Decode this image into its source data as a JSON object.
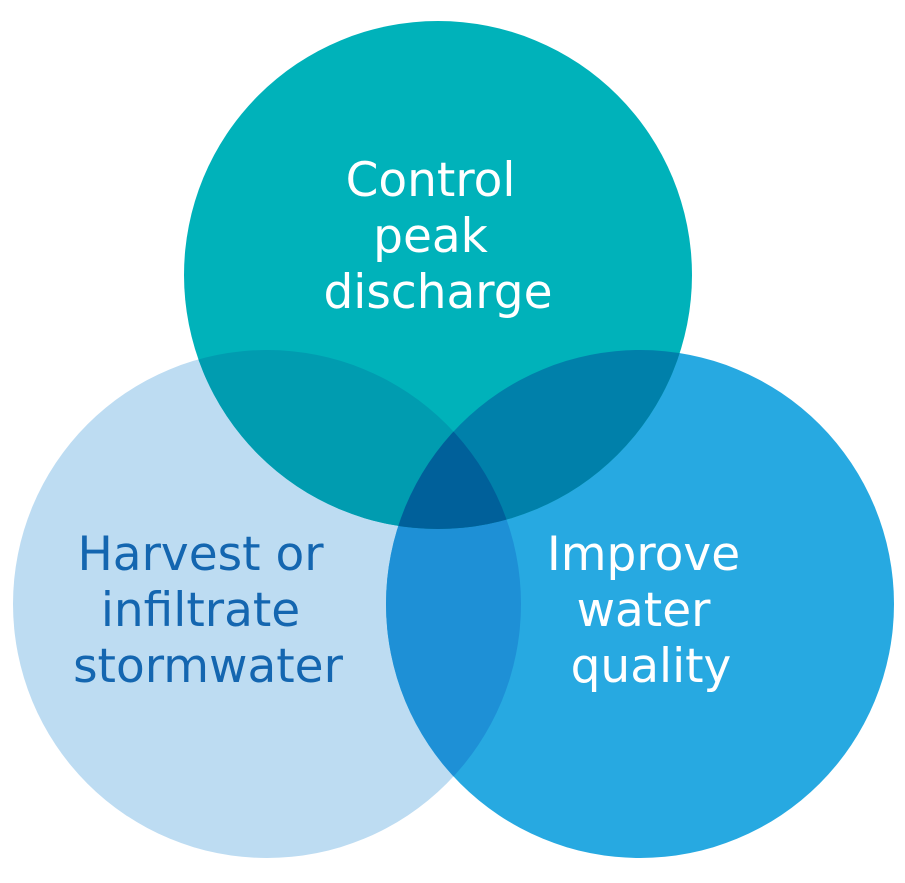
{
  "venn": {
    "circles": [
      {
        "id": "control-peak-discharge",
        "lines": [
          "Control",
          "peak",
          "discharge"
        ],
        "fill": "#00B2BA",
        "text_color": "#FFFFFF"
      },
      {
        "id": "harvest-or-infiltrate-stormwater",
        "lines": [
          "Harvest or",
          "infiltrate",
          "stormwater"
        ],
        "fill": "#BDDCF2",
        "text_color": "#1466B0"
      },
      {
        "id": "improve-water-quality",
        "lines": [
          "Improve",
          "water",
          "quality"
        ],
        "fill": "#27A9E1",
        "text_color": "#FFFFFF"
      }
    ],
    "overlap_colors": {
      "top_left": "#009CB0",
      "top_right": "#0080AA",
      "left_right": "#1E90D6",
      "center": "#00609A"
    }
  }
}
